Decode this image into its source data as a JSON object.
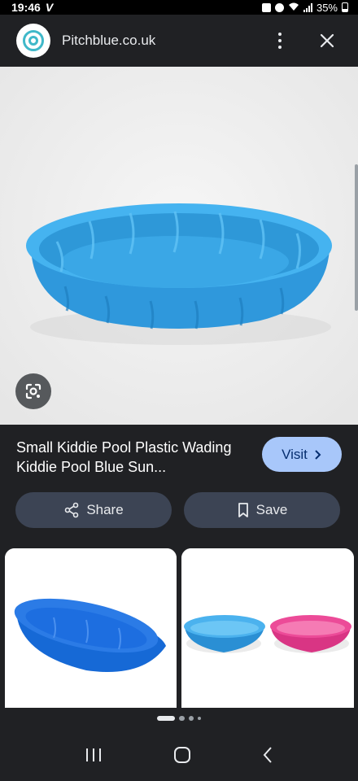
{
  "status_bar": {
    "time": "19:46",
    "carrier_icon": "V",
    "battery": "35%"
  },
  "top_bar": {
    "site_name": "Pitchblue.co.uk",
    "menu_icon": "more-vert-icon",
    "close_icon": "close-icon"
  },
  "result": {
    "title": "Small Kiddie Pool Plastic Wading Kiddie Pool Blue Sun...",
    "visit_label": "Visit",
    "share_label": "Share",
    "save_label": "Save"
  },
  "colors": {
    "visit_bg": "#a8c7fa",
    "pill_bg": "#3c4454",
    "pool_blue": "#35a7e8",
    "pool_pink": "#e9438f",
    "page_bg": "#202124"
  }
}
